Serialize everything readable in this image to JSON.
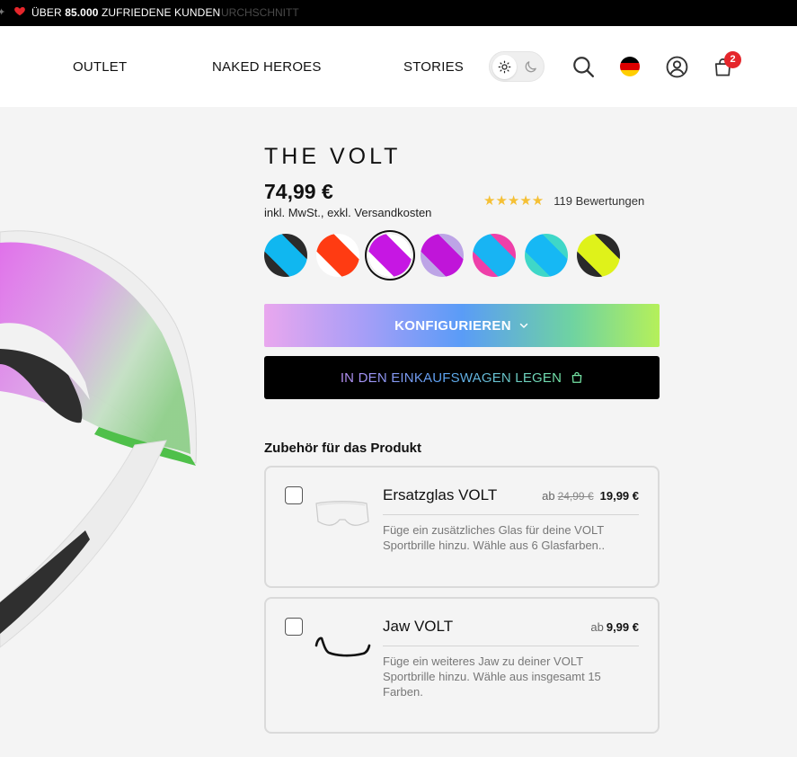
{
  "announcement": {
    "text_before": "ÜBER",
    "number": "85.000",
    "text_after": "ZUFRIEDENE KUNDEN",
    "ghost_text": "URCHSCHNITT"
  },
  "nav": {
    "items": [
      "OUTLET",
      "NAKED HEROES",
      "STORIES"
    ],
    "cart_count": "2"
  },
  "product": {
    "title": "THE VOLT",
    "price": "74,99 €",
    "price_note": "inkl. MwSt., exkl. Versandkosten",
    "rating_stars": "★★★★★",
    "rating_value": 5,
    "review_count": "119 Bewertungen",
    "swatches": [
      {
        "name": "black-blue",
        "colors": [
          "#2b2b2b",
          "#10b7f0"
        ]
      },
      {
        "name": "white-red",
        "colors": [
          "#ffffff",
          "#ff3b12"
        ]
      },
      {
        "name": "white-purple",
        "colors": [
          "#ffffff",
          "#c617e3"
        ]
      },
      {
        "name": "lilac-purple",
        "colors": [
          "#bda4e6",
          "#c015d9"
        ]
      },
      {
        "name": "pink-blue",
        "colors": [
          "#ee3fa9",
          "#18b4f3"
        ]
      },
      {
        "name": "teal-blue",
        "colors": [
          "#3fd7c8",
          "#16b8f4"
        ]
      },
      {
        "name": "black-lime",
        "colors": [
          "#2a2a2a",
          "#dff21a"
        ]
      }
    ],
    "selected_swatch_index": 2
  },
  "buttons": {
    "configure_label": "KONFIGURIEREN",
    "cart_label": "IN DEN EINKAUFSWAGEN LEGEN"
  },
  "accessories": {
    "heading": "Zubehör für das Produkt",
    "items": [
      {
        "name": "Ersatzglas VOLT",
        "from_label": "ab",
        "old_price": "24,99 €",
        "price": "19,99 €",
        "description": "Füge ein zusätzliches Glas für deine VOLT Sportbrille hinzu. Wähle aus 6 Glasfarben.."
      },
      {
        "name": "Jaw VOLT",
        "from_label": "ab",
        "price": "9,99 €",
        "description": "Füge ein weiteres Jaw zu deiner VOLT Sportbrille hinzu. Wähle aus insgesamt 15 Farben."
      }
    ]
  },
  "colors": {
    "background": "#f4f4f4",
    "announcement_bg": "#000000",
    "badge": "#e5262b",
    "star": "#f5c035"
  }
}
